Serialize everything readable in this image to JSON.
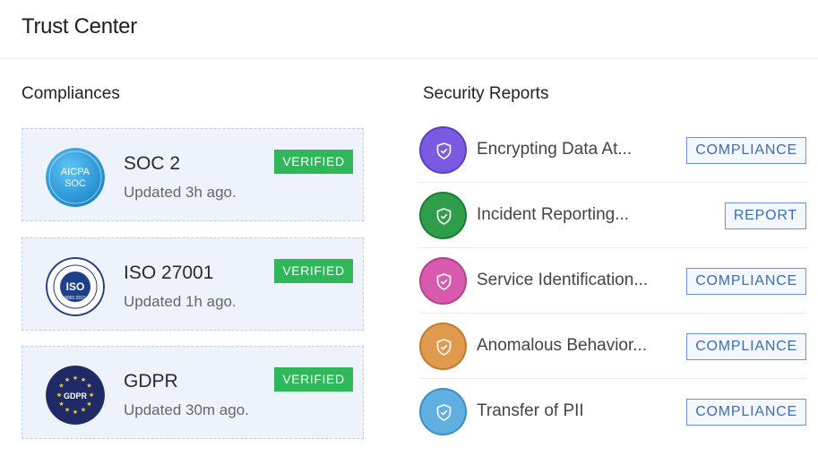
{
  "header": {
    "title": "Trust Center"
  },
  "compliances": {
    "title": "Compliances",
    "items": [
      {
        "name": "SOC 2",
        "updated": "Updated 3h ago.",
        "status": "VERIFIED",
        "logo_icon": "aicpa-soc-icon",
        "logo_text_1": "AICPA",
        "logo_text_2": "SOC"
      },
      {
        "name": "ISO 27001",
        "updated": "Updated 1h ago.",
        "status": "VERIFIED",
        "logo_icon": "iso-certified-icon",
        "logo_text_1": "ISO",
        "logo_text_2": "9001:2015"
      },
      {
        "name": "GDPR",
        "updated": "Updated 30m ago.",
        "status": "VERIFIED",
        "logo_icon": "gdpr-icon",
        "logo_text_1": "GDPR"
      }
    ]
  },
  "security_reports": {
    "title": "Security Reports",
    "items": [
      {
        "label": "Encrypting Data At...",
        "tag": "COMPLIANCE",
        "color": "#7a5ae0",
        "ring": "#5b3fc4"
      },
      {
        "label": "Incident Reporting...",
        "tag": "REPORT",
        "color": "#2e9e4a",
        "ring": "#1f7a36"
      },
      {
        "label": "Service Identification...",
        "tag": "COMPLIANCE",
        "color": "#d85aaf",
        "ring": "#b93f90"
      },
      {
        "label": "Anomalous Behavior...",
        "tag": "COMPLIANCE",
        "color": "#df9a4e",
        "ring": "#c27a30"
      },
      {
        "label": "Transfer of PII",
        "tag": "COMPLIANCE",
        "color": "#5fb0e0",
        "ring": "#3c8fc4"
      }
    ]
  },
  "colors": {
    "verified": "#2eb85a",
    "tag_border": "#6a93d8",
    "tag_text": "#3a6cc4",
    "card_bg": "#eef3fb"
  }
}
